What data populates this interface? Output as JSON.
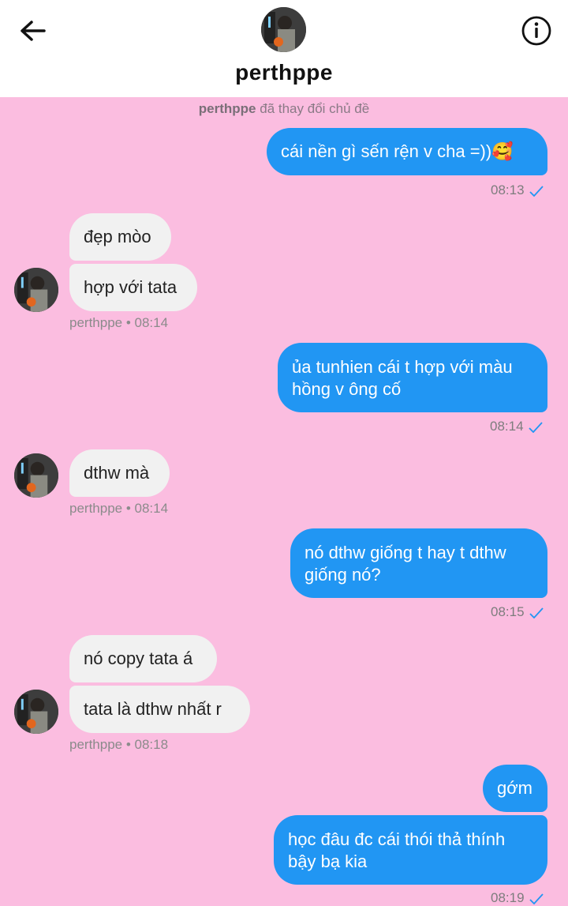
{
  "header": {
    "username": "perthppe"
  },
  "notice": {
    "actor": "perthppe",
    "text": "đã thay đổi chủ đề"
  },
  "messages": [
    {
      "dir": "out",
      "text": "cái nền gì sến rện v cha =))🥰",
      "time": "08:13"
    },
    {
      "dir": "in",
      "text": "đẹp mòo"
    },
    {
      "dir": "in",
      "text": "hợp với tata",
      "meta": "perthppe • 08:14"
    },
    {
      "dir": "out",
      "line1": "ủa tunhien cái t hợp với màu",
      "line2": "hồng v ông cố",
      "time": "08:14"
    },
    {
      "dir": "in",
      "text": "dthw mà",
      "meta": "perthppe • 08:14"
    },
    {
      "dir": "out",
      "line1": "nó dthw giống t hay t dthw",
      "line2": "giống nó?",
      "time": "08:15"
    },
    {
      "dir": "in",
      "text": "nó copy tata á"
    },
    {
      "dir": "in",
      "text": "tata là dthw nhất r",
      "meta": "perthppe • 08:18"
    },
    {
      "dir": "out",
      "text": "gớm"
    },
    {
      "dir": "out",
      "line1": "học đâu đc cái thói thả thính",
      "line2": "bậy bạ kia",
      "time": "08:19"
    }
  ]
}
